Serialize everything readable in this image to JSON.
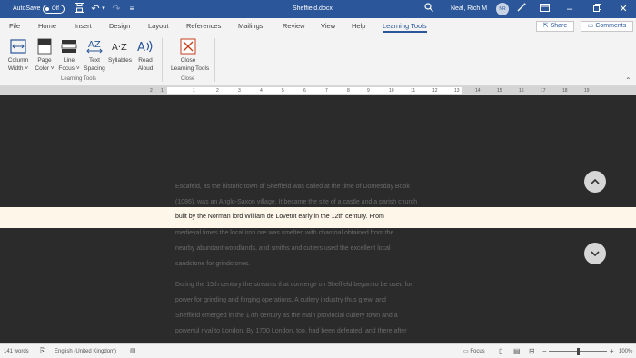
{
  "titlebar": {
    "autosave_label": "AutoSave",
    "autosave_state": "Off",
    "filename": "Sheffield.docx",
    "user_name": "Neal, Rich M",
    "user_initials": "NR"
  },
  "tabs": [
    {
      "label": "File"
    },
    {
      "label": "Home"
    },
    {
      "label": "Insert"
    },
    {
      "label": "Design"
    },
    {
      "label": "Layout"
    },
    {
      "label": "References"
    },
    {
      "label": "Mailings"
    },
    {
      "label": "Review"
    },
    {
      "label": "View"
    },
    {
      "label": "Help"
    },
    {
      "label": "Learning Tools"
    }
  ],
  "share_label": "Share",
  "comments_label": "Comments",
  "ribbon": {
    "buttons": [
      {
        "line1": "Column",
        "line2": "Width ˅"
      },
      {
        "line1": "Page",
        "line2": "Color ˅"
      },
      {
        "line1": "Line",
        "line2": "Focus ˅"
      },
      {
        "line1": "Text",
        "line2": "Spacing"
      },
      {
        "line1": "Syllables",
        "line2": ""
      },
      {
        "line1": "Read",
        "line2": "Aloud"
      },
      {
        "line1": "Close",
        "line2": "Learning Tools"
      }
    ],
    "groups": [
      "Learning Tools",
      "Close"
    ]
  },
  "ruler_numbers": [
    "2",
    "1",
    "1",
    "2",
    "3",
    "4",
    "5",
    "6",
    "7",
    "8",
    "9",
    "10",
    "11",
    "12",
    "13",
    "14",
    "15",
    "16",
    "17",
    "18",
    "19"
  ],
  "document": {
    "lines_before": [
      "Escafeld, as the historic town of Sheffield was called at the time of Domesday Book",
      "(1086), was an Anglo-Saxon village. It became the site of a castle and a parish church"
    ],
    "focus_line": "built by the Norman lord William de Lovetot early in the 12th century. From",
    "lines_after": [
      "medieval times the local iron ore was smelted with charcoal obtained from the",
      "nearby abundant woodlands, and smiths and cutlers used the excellent local",
      "sandstone for grindstones.",
      "During the 15th century the streams that converge on Sheffield began to be used for",
      "power for grinding and forging operations. A cutlery industry thus grew, and",
      "Sheffield emerged in the 17th century as the main provincial cutlery town and a",
      "powerful rival to London. By 1700 London, too, had been defeated, and there after"
    ]
  },
  "statusbar": {
    "word_count": "141 words",
    "language": "English (United Kingdom)",
    "focus_label": "Focus",
    "zoom": "100%",
    "zoom_fraction": 0.5
  },
  "colors": {
    "title_bar": "#2b579a",
    "focus_band": "#fff6ea",
    "page": "#2b2b2b"
  }
}
